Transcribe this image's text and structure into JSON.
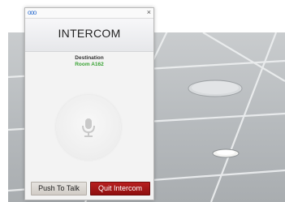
{
  "window": {
    "controls_icon": "ooo",
    "close_icon": "×"
  },
  "header": {
    "title": "INTERCOM"
  },
  "destination": {
    "label": "Destination",
    "value": "Room A162"
  },
  "mic": {
    "icon": "microphone-icon"
  },
  "buttons": {
    "push_to_talk": "Push To Talk",
    "quit": "Quit Intercom"
  },
  "colors": {
    "destination_value": "#3aa335",
    "quit_button": "#a31616",
    "window_controls": "#2e6fd0"
  }
}
